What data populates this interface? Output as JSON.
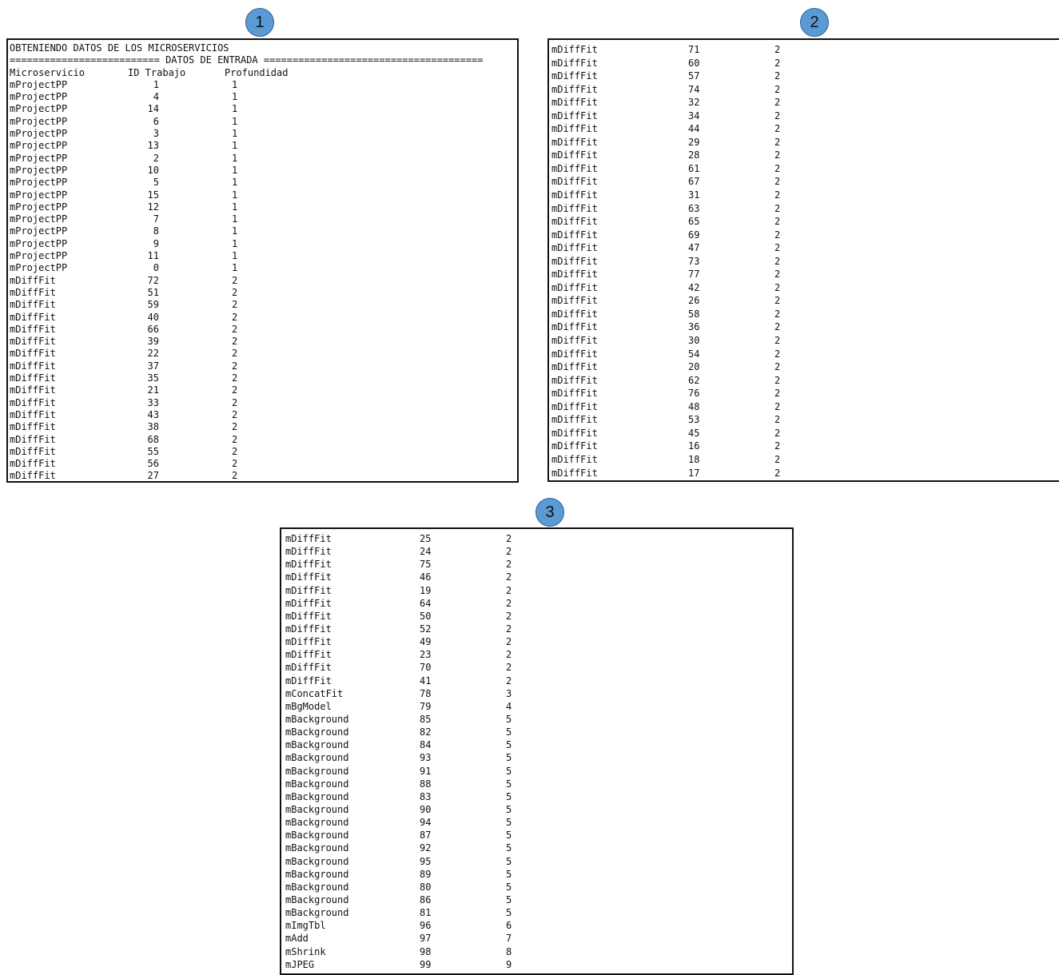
{
  "badges": [
    "1",
    "2",
    "3"
  ],
  "panel1": {
    "title_line": "OBTENIENDO DATOS DE LOS MICROSERVICIOS",
    "separator_line": "========================== DATOS DE ENTRADA ======================================",
    "headers": {
      "microservice": "Microservicio",
      "job_id": "ID Trabajo",
      "depth": "Profundidad"
    },
    "rows": [
      [
        "mProjectPP",
        "1",
        "1"
      ],
      [
        "mProjectPP",
        "4",
        "1"
      ],
      [
        "mProjectPP",
        "14",
        "1"
      ],
      [
        "mProjectPP",
        "6",
        "1"
      ],
      [
        "mProjectPP",
        "3",
        "1"
      ],
      [
        "mProjectPP",
        "13",
        "1"
      ],
      [
        "mProjectPP",
        "2",
        "1"
      ],
      [
        "mProjectPP",
        "10",
        "1"
      ],
      [
        "mProjectPP",
        "5",
        "1"
      ],
      [
        "mProjectPP",
        "15",
        "1"
      ],
      [
        "mProjectPP",
        "12",
        "1"
      ],
      [
        "mProjectPP",
        "7",
        "1"
      ],
      [
        "mProjectPP",
        "8",
        "1"
      ],
      [
        "mProjectPP",
        "9",
        "1"
      ],
      [
        "mProjectPP",
        "11",
        "1"
      ],
      [
        "mProjectPP",
        "0",
        "1"
      ],
      [
        "mDiffFit",
        "72",
        "2"
      ],
      [
        "mDiffFit",
        "51",
        "2"
      ],
      [
        "mDiffFit",
        "59",
        "2"
      ],
      [
        "mDiffFit",
        "40",
        "2"
      ],
      [
        "mDiffFit",
        "66",
        "2"
      ],
      [
        "mDiffFit",
        "39",
        "2"
      ],
      [
        "mDiffFit",
        "22",
        "2"
      ],
      [
        "mDiffFit",
        "37",
        "2"
      ],
      [
        "mDiffFit",
        "35",
        "2"
      ],
      [
        "mDiffFit",
        "21",
        "2"
      ],
      [
        "mDiffFit",
        "33",
        "2"
      ],
      [
        "mDiffFit",
        "43",
        "2"
      ],
      [
        "mDiffFit",
        "38",
        "2"
      ],
      [
        "mDiffFit",
        "68",
        "2"
      ],
      [
        "mDiffFit",
        "55",
        "2"
      ],
      [
        "mDiffFit",
        "56",
        "2"
      ],
      [
        "mDiffFit",
        "27",
        "2"
      ]
    ]
  },
  "panel2": {
    "rows": [
      [
        "mDiffFit",
        "71",
        "2"
      ],
      [
        "mDiffFit",
        "60",
        "2"
      ],
      [
        "mDiffFit",
        "57",
        "2"
      ],
      [
        "mDiffFit",
        "74",
        "2"
      ],
      [
        "mDiffFit",
        "32",
        "2"
      ],
      [
        "mDiffFit",
        "34",
        "2"
      ],
      [
        "mDiffFit",
        "44",
        "2"
      ],
      [
        "mDiffFit",
        "29",
        "2"
      ],
      [
        "mDiffFit",
        "28",
        "2"
      ],
      [
        "mDiffFit",
        "61",
        "2"
      ],
      [
        "mDiffFit",
        "67",
        "2"
      ],
      [
        "mDiffFit",
        "31",
        "2"
      ],
      [
        "mDiffFit",
        "63",
        "2"
      ],
      [
        "mDiffFit",
        "65",
        "2"
      ],
      [
        "mDiffFit",
        "69",
        "2"
      ],
      [
        "mDiffFit",
        "47",
        "2"
      ],
      [
        "mDiffFit",
        "73",
        "2"
      ],
      [
        "mDiffFit",
        "77",
        "2"
      ],
      [
        "mDiffFit",
        "42",
        "2"
      ],
      [
        "mDiffFit",
        "26",
        "2"
      ],
      [
        "mDiffFit",
        "58",
        "2"
      ],
      [
        "mDiffFit",
        "36",
        "2"
      ],
      [
        "mDiffFit",
        "30",
        "2"
      ],
      [
        "mDiffFit",
        "54",
        "2"
      ],
      [
        "mDiffFit",
        "20",
        "2"
      ],
      [
        "mDiffFit",
        "62",
        "2"
      ],
      [
        "mDiffFit",
        "76",
        "2"
      ],
      [
        "mDiffFit",
        "48",
        "2"
      ],
      [
        "mDiffFit",
        "53",
        "2"
      ],
      [
        "mDiffFit",
        "45",
        "2"
      ],
      [
        "mDiffFit",
        "16",
        "2"
      ],
      [
        "mDiffFit",
        "18",
        "2"
      ],
      [
        "mDiffFit",
        "17",
        "2"
      ]
    ]
  },
  "panel3": {
    "rows": [
      [
        "mDiffFit",
        "25",
        "2"
      ],
      [
        "mDiffFit",
        "24",
        "2"
      ],
      [
        "mDiffFit",
        "75",
        "2"
      ],
      [
        "mDiffFit",
        "46",
        "2"
      ],
      [
        "mDiffFit",
        "19",
        "2"
      ],
      [
        "mDiffFit",
        "64",
        "2"
      ],
      [
        "mDiffFit",
        "50",
        "2"
      ],
      [
        "mDiffFit",
        "52",
        "2"
      ],
      [
        "mDiffFit",
        "49",
        "2"
      ],
      [
        "mDiffFit",
        "23",
        "2"
      ],
      [
        "mDiffFit",
        "70",
        "2"
      ],
      [
        "mDiffFit",
        "41",
        "2"
      ],
      [
        "mConcatFit",
        "78",
        "3"
      ],
      [
        "mBgModel",
        "79",
        "4"
      ],
      [
        "mBackground",
        "85",
        "5"
      ],
      [
        "mBackground",
        "82",
        "5"
      ],
      [
        "mBackground",
        "84",
        "5"
      ],
      [
        "mBackground",
        "93",
        "5"
      ],
      [
        "mBackground",
        "91",
        "5"
      ],
      [
        "mBackground",
        "88",
        "5"
      ],
      [
        "mBackground",
        "83",
        "5"
      ],
      [
        "mBackground",
        "90",
        "5"
      ],
      [
        "mBackground",
        "94",
        "5"
      ],
      [
        "mBackground",
        "87",
        "5"
      ],
      [
        "mBackground",
        "92",
        "5"
      ],
      [
        "mBackground",
        "95",
        "5"
      ],
      [
        "mBackground",
        "89",
        "5"
      ],
      [
        "mBackground",
        "80",
        "5"
      ],
      [
        "mBackground",
        "86",
        "5"
      ],
      [
        "mBackground",
        "81",
        "5"
      ],
      [
        "mImgTbl",
        "96",
        "6"
      ],
      [
        "mAdd",
        "97",
        "7"
      ],
      [
        "mShrink",
        "98",
        "8"
      ],
      [
        "mJPEG",
        "99",
        "9"
      ]
    ]
  }
}
